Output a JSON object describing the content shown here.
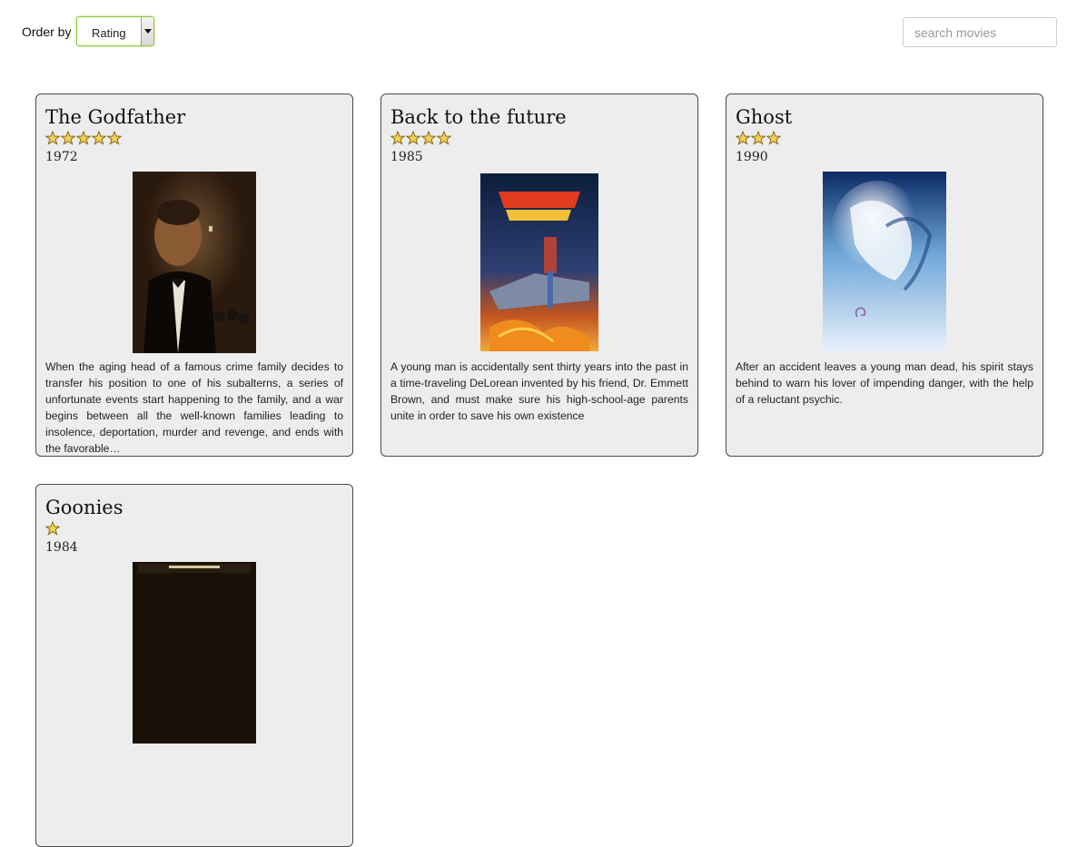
{
  "toolbar": {
    "order_label": "Order by",
    "order_selected": "Rating",
    "search_placeholder": "search movies",
    "search_value": ""
  },
  "movies": [
    {
      "title": "The Godfather",
      "rating": 5,
      "year": "1972",
      "description": "When the aging head of a famous crime family decides to transfer his position to one of his subalterns, a series of unfortunate events start happening to the family, and a war begins between all the well-known families leading to insolence, deportation, murder and revenge, and ends with the favorable…"
    },
    {
      "title": "Back to the future",
      "rating": 4,
      "year": "1985",
      "description": "A young man is accidentally sent thirty years into the past in a time-traveling DeLorean invented by his friend, Dr. Emmett Brown, and must make sure his high-school-age parents unite in order to save his own existence"
    },
    {
      "title": "Ghost",
      "rating": 3,
      "year": "1990",
      "description": "After an accident leaves a young man dead, his spirit stays behind to warn his lover of impending danger, with the help of a reluctant psychic."
    },
    {
      "title": "Goonies",
      "rating": 1,
      "year": "1984",
      "description": ""
    }
  ],
  "colors": {
    "star_fill": "#f2d25c",
    "star_stroke": "#8a6a10",
    "card_bg": "#ededed",
    "select_focus": "#8fc43a"
  },
  "icons": {
    "star": "star-icon",
    "dropdown": "chevron-down-icon"
  }
}
